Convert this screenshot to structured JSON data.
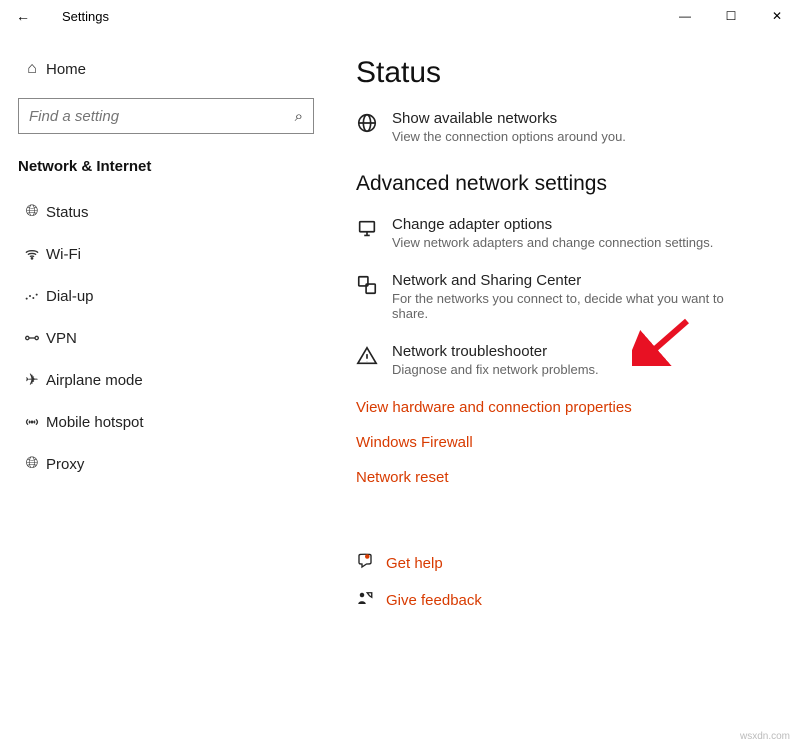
{
  "titlebar": {
    "title": "Settings"
  },
  "sidebar": {
    "home": "Home",
    "search_placeholder": "Find a setting",
    "category": "Network & Internet",
    "items": [
      {
        "label": "Status"
      },
      {
        "label": "Wi-Fi"
      },
      {
        "label": "Dial-up"
      },
      {
        "label": "VPN"
      },
      {
        "label": "Airplane mode"
      },
      {
        "label": "Mobile hotspot"
      },
      {
        "label": "Proxy"
      }
    ]
  },
  "main": {
    "title": "Status",
    "show_networks": {
      "title": "Show available networks",
      "desc": "View the connection options around you."
    },
    "section": "Advanced network settings",
    "adapter": {
      "title": "Change adapter options",
      "desc": "View network adapters and change connection settings."
    },
    "sharing": {
      "title": "Network and Sharing Center",
      "desc": "For the networks you connect to, decide what you want to share."
    },
    "troubleshoot": {
      "title": "Network troubleshooter",
      "desc": "Diagnose and fix network problems."
    },
    "links": {
      "hardware": "View hardware and connection properties",
      "firewall": "Windows Firewall",
      "reset": "Network reset"
    },
    "help": {
      "get": "Get help",
      "feedback": "Give feedback"
    }
  },
  "watermark": "wsxdn.com"
}
